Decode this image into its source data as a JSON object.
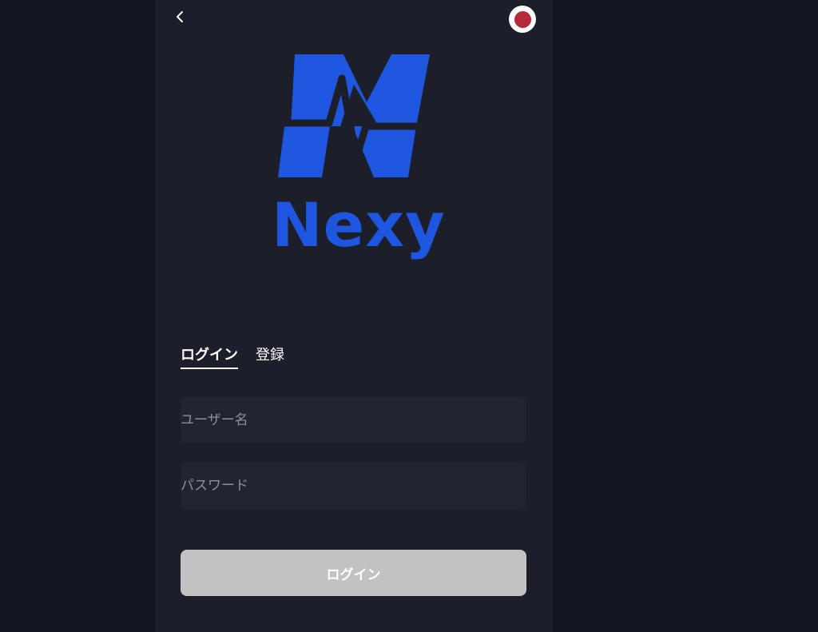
{
  "header": {
    "back_icon": "chevron-left-icon",
    "language_icon": "japan-flag-icon"
  },
  "brand": {
    "name": "Nexy",
    "color": "#1f56e0"
  },
  "tabs": [
    {
      "label": "ログイン",
      "active": true
    },
    {
      "label": "登録",
      "active": false
    }
  ],
  "form": {
    "username": {
      "value": "",
      "placeholder": "ユーザー名"
    },
    "password": {
      "value": "",
      "placeholder": "パスワード"
    },
    "submit_label": "ログイン"
  },
  "colors": {
    "flag_red": "#b7283a",
    "button_disabled": "#c2c2c2"
  }
}
